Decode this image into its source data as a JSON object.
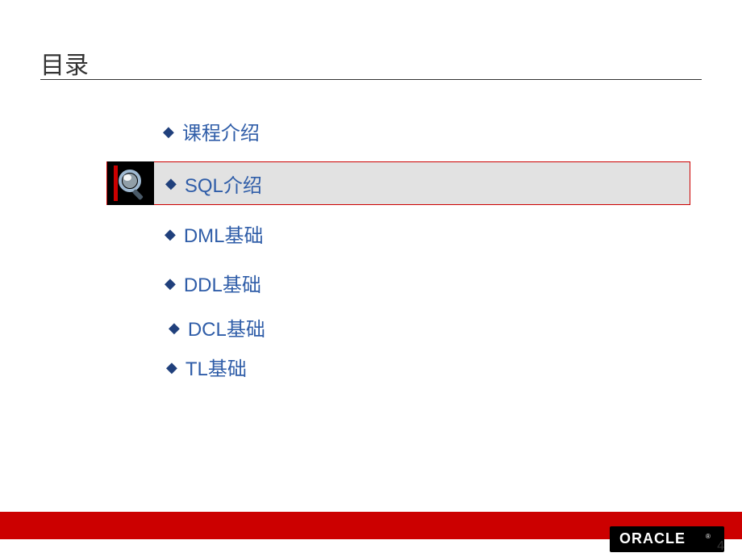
{
  "title": "目录",
  "toc": {
    "items": [
      {
        "label": "课程介绍"
      },
      {
        "label": "SQL介绍"
      },
      {
        "label": "DML基础"
      },
      {
        "label": "DDL基础"
      },
      {
        "label": "DCL基础"
      },
      {
        "label": "TL基础"
      }
    ]
  },
  "bullet_glyph": "◆",
  "footer": {
    "brand": "ORACLE"
  },
  "page_number": "4"
}
